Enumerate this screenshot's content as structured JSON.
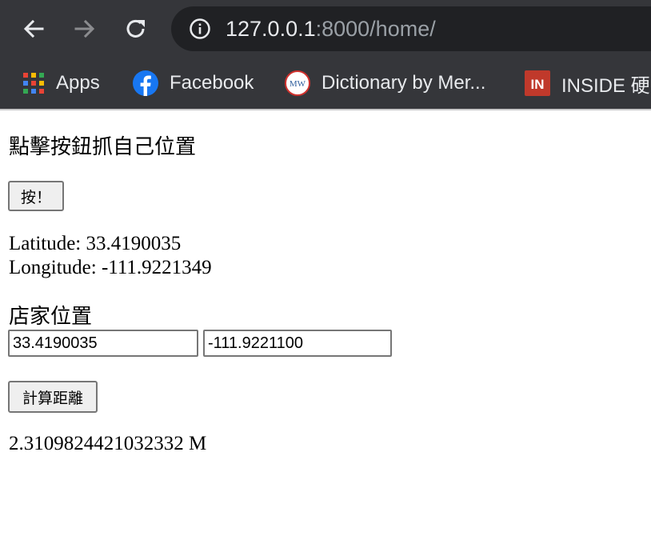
{
  "browser": {
    "url_host": "127.0.0.1",
    "url_rest": ":8000/home/",
    "bookmarks": [
      {
        "label": "Apps",
        "icon": "apps-grid-icon"
      },
      {
        "label": "Facebook",
        "icon": "facebook-icon"
      },
      {
        "label": "Dictionary by Mer...",
        "icon": "merriam-webster-icon",
        "icon_text": "MW"
      },
      {
        "label": "INSIDE 硬",
        "icon": "inside-icon",
        "icon_text": "IN"
      }
    ],
    "colors": {
      "chrome_bg": "#35363a",
      "omnibox_bg": "#202124",
      "text": "#e8eaed",
      "muted": "#9aa0a6",
      "facebook": "#1877f2",
      "inside": "#c0392b"
    }
  },
  "page": {
    "heading": "點擊按鈕抓自己位置",
    "locate_button": "按！",
    "latitude_line": "Latitude: 33.4190035",
    "longitude_line": "Longitude: -111.9221349",
    "store_label": "店家位置",
    "store_latitude": "33.4190035",
    "store_longitude": "-111.9221100",
    "calc_button": "計算距離",
    "result": "2.3109824421032332 M"
  }
}
